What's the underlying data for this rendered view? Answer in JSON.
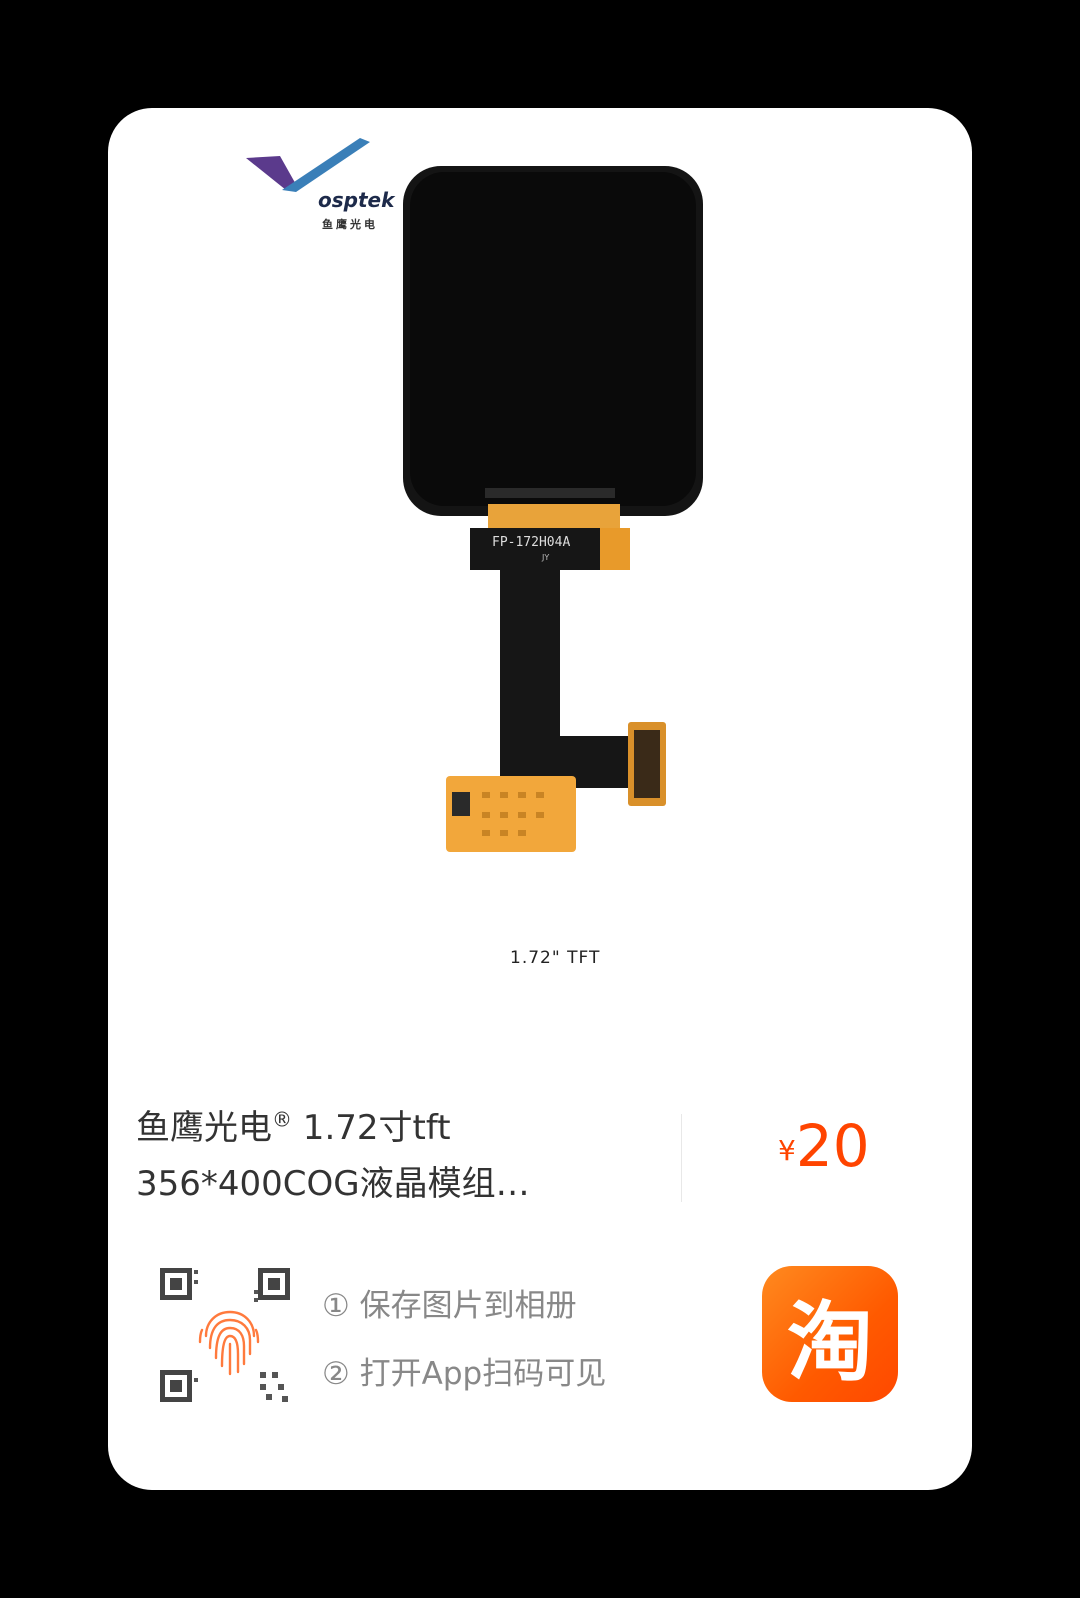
{
  "product": {
    "brand_name": "osptek",
    "brand_sub": "鱼鹰光电",
    "fpc_label": "FP-172H04A",
    "fpc_sub": "JY",
    "caption": "1.72\" TFT"
  },
  "listing": {
    "title_line1": "鱼鹰光电",
    "title_reg": "®",
    "title_line1_rest": " 1.72寸tft",
    "title_line2": "356*400COG液晶模组…",
    "price_currency": "¥",
    "price_amount": "20"
  },
  "share": {
    "step1": "① 保存图片到相册",
    "step2": "② 打开App扫码可见",
    "app_icon_char": "淘"
  },
  "colors": {
    "price": "#ff4400",
    "app_icon": "#ff5a00",
    "fingerprint": "#ff7a3d"
  }
}
